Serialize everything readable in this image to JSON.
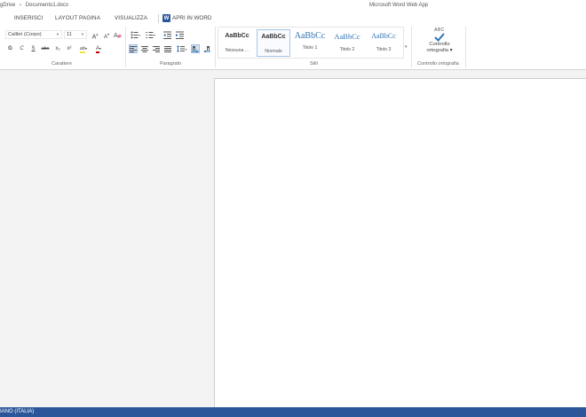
{
  "titlebar": {
    "location": "gDrive",
    "separator": "›",
    "document": "Documento1.docx",
    "app_title": "Microsoft Word Web App"
  },
  "tabs": [
    {
      "label": "INSERISCI"
    },
    {
      "label": "LAYOUT PAGINA"
    },
    {
      "label": "VISUALIZZA"
    }
  ],
  "open_in_word": {
    "label": "APRI IN WORD",
    "icon": "word-icon",
    "icon_letter": "W"
  },
  "ribbon": {
    "font": {
      "font_name": "Calibri (Corpo)",
      "font_size": "11",
      "grow": "A",
      "shrink": "A",
      "bold": "G",
      "italic": "C",
      "underline": "S",
      "strike": "abc",
      "subscript": "x₂",
      "superscript": "x²",
      "highlight": "ab",
      "font_color": "A",
      "label": "Carattere"
    },
    "paragraph": {
      "label": "Paragrafo"
    },
    "styles": {
      "label": "Stili",
      "items": [
        {
          "sample": "AaBbCc",
          "name": "Nessuna ..."
        },
        {
          "sample": "AaBbCc",
          "name": "Normale"
        },
        {
          "sample": "AaBbCc",
          "name": "Titolo 1"
        },
        {
          "sample": "AaBbCc",
          "name": "Titolo 2"
        },
        {
          "sample": "AaBbCc",
          "name": "Titolo 3"
        }
      ],
      "selected_index": 1
    },
    "proofing": {
      "abc": "ABC",
      "button_line1": "Controllo",
      "button_line2": "ortografia ▾",
      "label": "Controllo ortografia"
    }
  },
  "statusbar": {
    "language": "IANO (ITALIA)"
  },
  "colors": {
    "accent": "#2b579a",
    "heading_blue": "#2e74b5",
    "highlight_yellow": "#f5e342",
    "font_color_red": "#c00000",
    "active_button_bg": "#cfe0f5"
  }
}
